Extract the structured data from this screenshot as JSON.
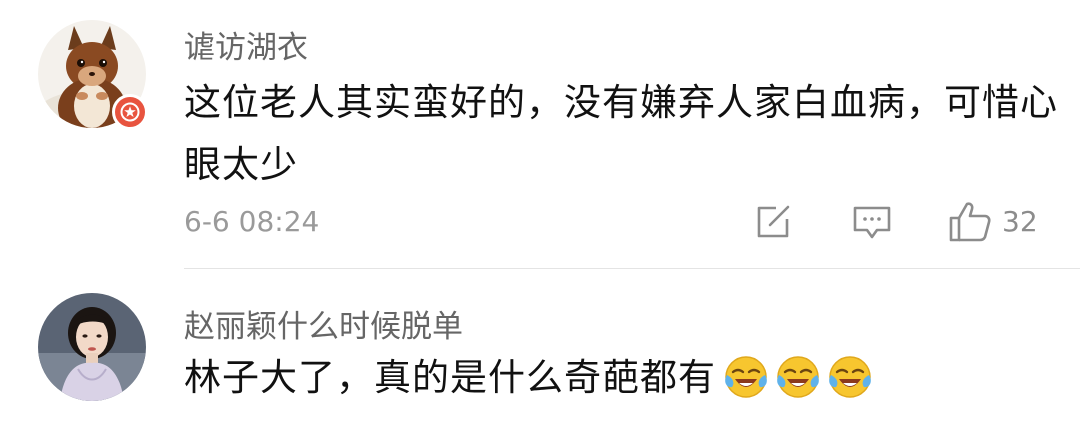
{
  "comments": [
    {
      "username": "谑访湖衣",
      "text": "这位老人其实蛮好的，没有嫌弃人家白血病，可惜心眼太少",
      "timestamp": "6-6 08:24",
      "like_count": "32",
      "avatar_icon": "squirrel-avatar",
      "badge_icon": "star-badge-icon",
      "badge_color": "#e8543f"
    },
    {
      "username": "赵丽颖什么时候脱单",
      "text": "林子大了，真的是什么奇葩都有",
      "emojis": [
        "laughing-crying-emoji",
        "laughing-crying-emoji",
        "laughing-crying-emoji"
      ],
      "avatar_icon": "woman-portrait-avatar"
    }
  ],
  "actions": {
    "share_icon": "share-icon",
    "reply_icon": "reply-icon",
    "like_icon": "like-icon"
  }
}
